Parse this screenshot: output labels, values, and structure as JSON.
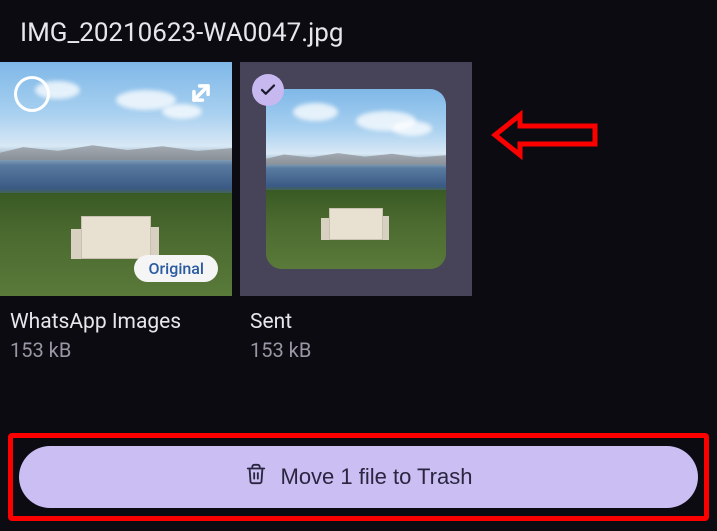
{
  "page_title": "IMG_20210623-WA0047.jpg",
  "cards": [
    {
      "title": "WhatsApp Images",
      "size": "153 kB",
      "badge": "Original",
      "selected": false
    },
    {
      "title": "Sent",
      "size": "153 kB",
      "selected": true
    }
  ],
  "trash_button_label": "Move 1 file to Trash"
}
